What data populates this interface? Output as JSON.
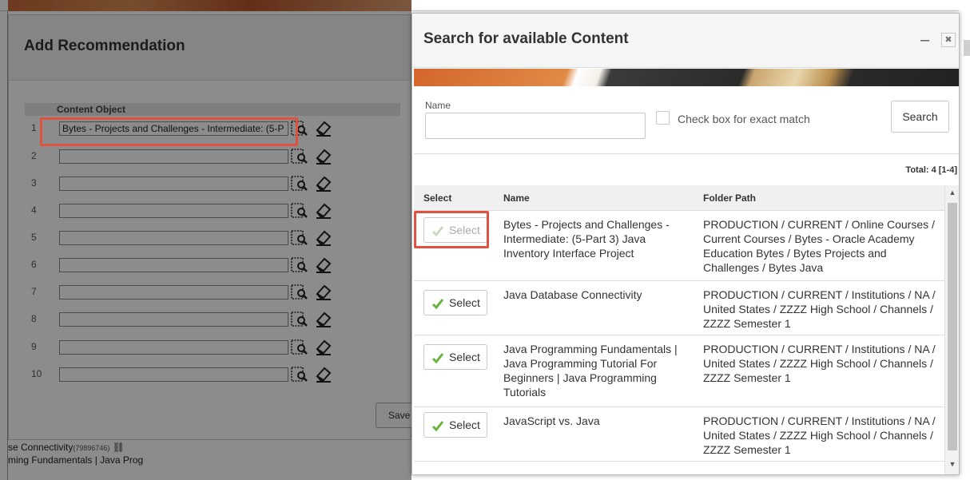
{
  "add_dialog": {
    "title": "Add Recommendation",
    "column_header": "Content Object",
    "rows": [
      {
        "num": "1",
        "value": "Bytes - Projects and Challenges - Intermediate: (5-P"
      },
      {
        "num": "2",
        "value": ""
      },
      {
        "num": "3",
        "value": ""
      },
      {
        "num": "4",
        "value": ""
      },
      {
        "num": "5",
        "value": ""
      },
      {
        "num": "6",
        "value": ""
      },
      {
        "num": "7",
        "value": ""
      },
      {
        "num": "8",
        "value": ""
      },
      {
        "num": "9",
        "value": ""
      },
      {
        "num": "10",
        "value": ""
      }
    ],
    "save_label": "Save"
  },
  "background": {
    "side_lines": [
      "se Connectivity",
      "ming Fundamentals | Java Prog"
    ],
    "side_line_id": "(79896746)"
  },
  "search_dialog": {
    "title": "Search for available Content",
    "minimize_label": "–",
    "close_label": "✖",
    "name_label": "Name",
    "name_value": "",
    "exact_match_label": "Check box for exact match",
    "search_button": "Search",
    "total": "Total:  4 [1-4]",
    "columns": {
      "select": "Select",
      "name": "Name",
      "folder_path": "Folder Path"
    },
    "results": [
      {
        "select_label": "Select",
        "name": "Bytes - Projects and Challenges - Intermediate: (5-Part 3) Java Inventory Interface Project",
        "folder_path": "PRODUCTION / CURRENT / Online Courses / Current Courses / Bytes - Oracle Academy Education Bytes / Bytes Projects and Challenges / Bytes Java",
        "disabled": true
      },
      {
        "select_label": "Select",
        "name": "Java Database Connectivity",
        "folder_path": "PRODUCTION / CURRENT / Institutions / NA / United States / ZZZZ High School / Channels / ZZZZ Semester 1",
        "disabled": false
      },
      {
        "select_label": "Select",
        "name": "Java Programming Fundamentals | Java Programming Tutorial For Beginners | Java Programming Tutorials",
        "folder_path": "PRODUCTION / CURRENT / Institutions / NA / United States / ZZZZ High School / Channels / ZZZZ Semester 1",
        "disabled": false
      },
      {
        "select_label": "Select",
        "name": "JavaScript vs. Java",
        "folder_path": "PRODUCTION / CURRENT / Institutions / NA / United States / ZZZZ High School / Channels / ZZZZ Semester 1",
        "disabled": false
      }
    ]
  },
  "colors": {
    "highlight": "#e0523f",
    "check_green": "#6ab43e",
    "overlay": "rgba(0,0,0,0.45)"
  }
}
